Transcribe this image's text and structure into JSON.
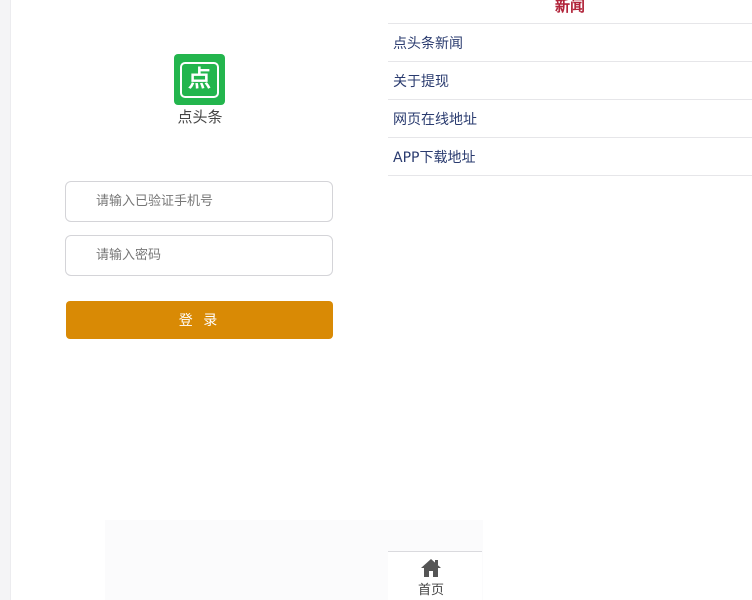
{
  "login": {
    "app_name": "点头条",
    "logo_char": "点",
    "phone_placeholder": "请输入已验证手机号",
    "password_placeholder": "请输入密码",
    "login_label": "登 录",
    "colors": {
      "logo": "#23b54d",
      "button": "#d98a05"
    }
  },
  "news": {
    "title": "新闻",
    "items": [
      {
        "label": "点头条新闻"
      },
      {
        "label": "关于提现"
      },
      {
        "label": "网页在线地址"
      },
      {
        "label": "APP下载地址"
      }
    ],
    "colors": {
      "title": "#b1243a",
      "item": "#2a3b6f"
    }
  },
  "tabbar": {
    "home_label": "首页",
    "home_icon": "home-icon"
  }
}
